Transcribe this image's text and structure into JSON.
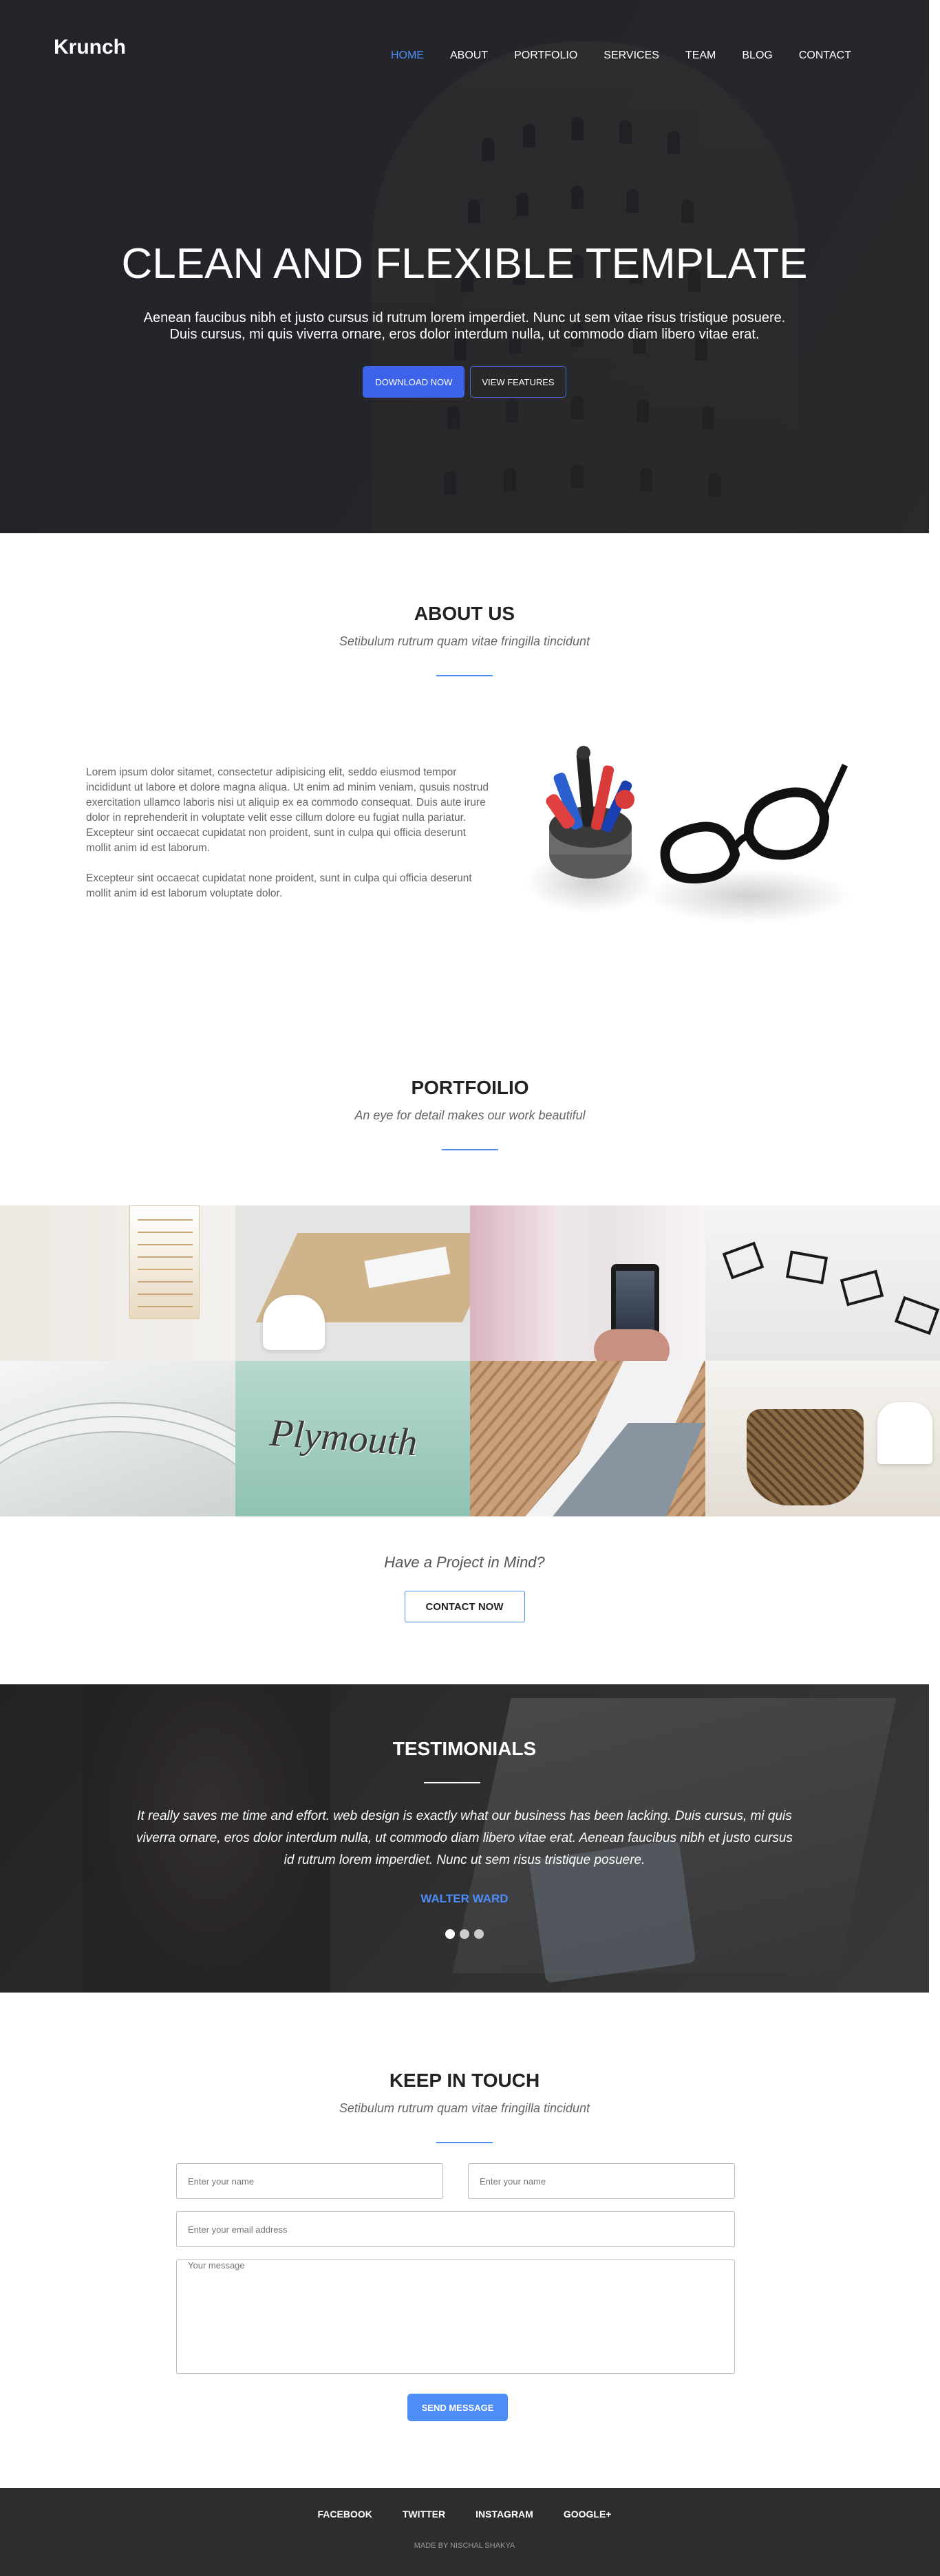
{
  "brand": "Krunch",
  "nav": [
    "HOME",
    "ABOUT",
    "PORTFOLIO",
    "SERVICES",
    "TEAM",
    "BLOG",
    "CONTACT"
  ],
  "hero": {
    "title": "CLEAN AND FLEXIBLE TEMPLATE",
    "line1": "Aenean faucibus nibh et justo cursus id rutrum lorem imperdiet. Nunc ut sem vitae risus tristique posuere.",
    "line2": "Duis cursus, mi quis viverra ornare, eros dolor interdum nulla, ut commodo diam libero vitae erat.",
    "download_label": "DOWNLOAD NOW",
    "features_label": "VIEW FEATURES"
  },
  "about": {
    "title": "ABOUT US",
    "subtitle": "Setibulum rutrum quam vitae fringilla tincidunt",
    "para1": "Lorem ipsum dolor sitamet, consectetur adipisicing elit, seddo eiusmod tempor incididunt ut labore et dolore magna aliqua. Ut enim ad minim veniam, qusuis nostrud exercitation ullamco laboris nisi ut aliquip ex ea commodo consequat. Duis aute irure dolor in reprehenderit in voluptate velit esse cillum dolore eu fugiat nulla pariatur. Excepteur sint occaecat cupidatat non proident, sunt in culpa qui officia deserunt mollit anim id est laborum.",
    "para2": "Excepteur sint occaecat cupidatat none proident, sunt in culpa qui officia deserunt mollit anim id est laborum voluptate dolor."
  },
  "portfolio": {
    "title": "PORTFOILIO",
    "subtitle": "An eye for detail makes our work beautiful",
    "plymouth_text": "Plymouth"
  },
  "project": {
    "question": "Have a Project in Mind?",
    "contact_label": "CONTACT NOW"
  },
  "testimonials": {
    "title": "TESTIMONIALS",
    "quote": "It really saves me time and effort. web design is exactly what our business has been lacking. Duis cursus, mi quis viverra ornare, eros dolor interdum nulla, ut commodo diam libero vitae erat. Aenean faucibus nibh et justo cursus id rutrum lorem imperdiet. Nunc ut sem risus tristique posuere.",
    "author": "WALTER WARD",
    "active_dot": 0
  },
  "contact": {
    "title": "KEEP IN TOUCH",
    "subtitle": "Setibulum rutrum quam vitae fringilla tincidunt",
    "name_placeholder": "Enter your name",
    "name2_placeholder": "Enter your name",
    "email_placeholder": "Enter your email address",
    "message_placeholder": "Your message",
    "send_label": "SEND MESSAGE"
  },
  "footer": {
    "links": [
      "FACEBOOK",
      "TWITTER",
      "INSTAGRAM",
      "GOOGLE+"
    ],
    "credit": "MADE BY NISCHAL SHAKYA"
  },
  "colors": {
    "accent": "#4d8df7",
    "hero_button": "#3c63e8",
    "footer_bg": "#2d2d2d"
  }
}
